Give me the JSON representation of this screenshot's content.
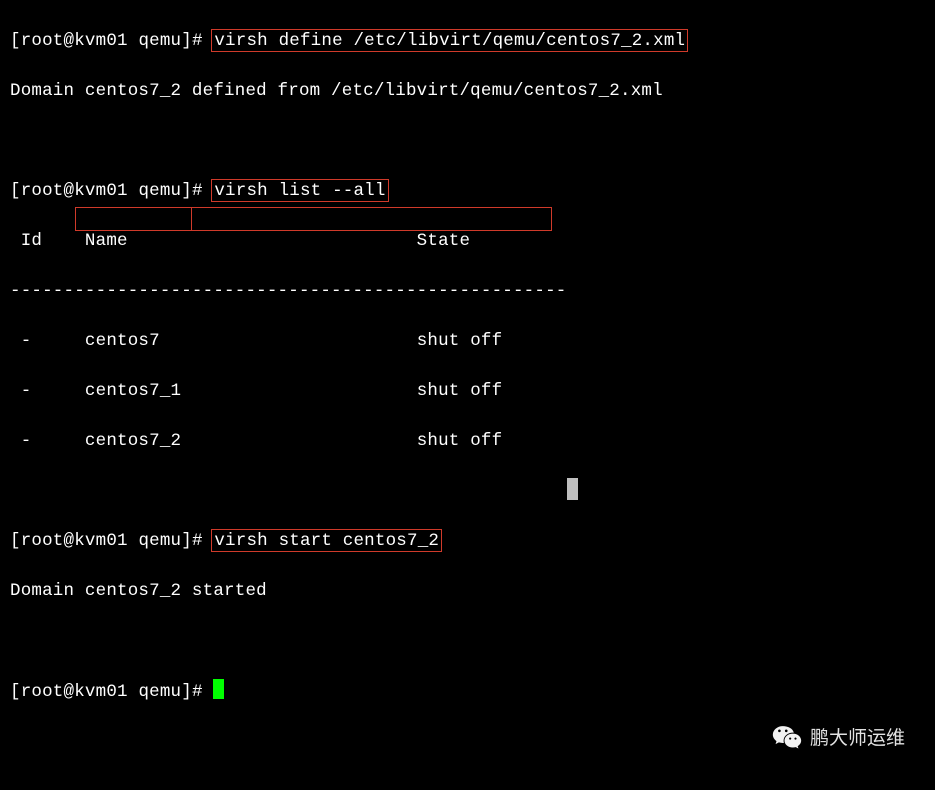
{
  "prompt_user": "root",
  "prompt_host": "kvm01",
  "prompt_dir": "qemu",
  "cmd1": "virsh define /etc/libvirt/qemu/centos7_2.xml",
  "out1": "Domain centos7_2 defined from /etc/libvirt/qemu/centos7_2.xml",
  "cmd2": "virsh list --all",
  "list_header": " Id    Name                           State",
  "list_sep": "----------------------------------------------------",
  "list_rows": [
    {
      "id": "-",
      "name": "centos7",
      "state": "shut off"
    },
    {
      "id": "-",
      "name": "centos7_1",
      "state": "shut off"
    },
    {
      "id": "-",
      "name": "centos7_2",
      "state": "shut off"
    }
  ],
  "cmd3": "virsh start centos7_2",
  "out3": "Domain centos7_2 started",
  "watermark": "鹏大师运维"
}
